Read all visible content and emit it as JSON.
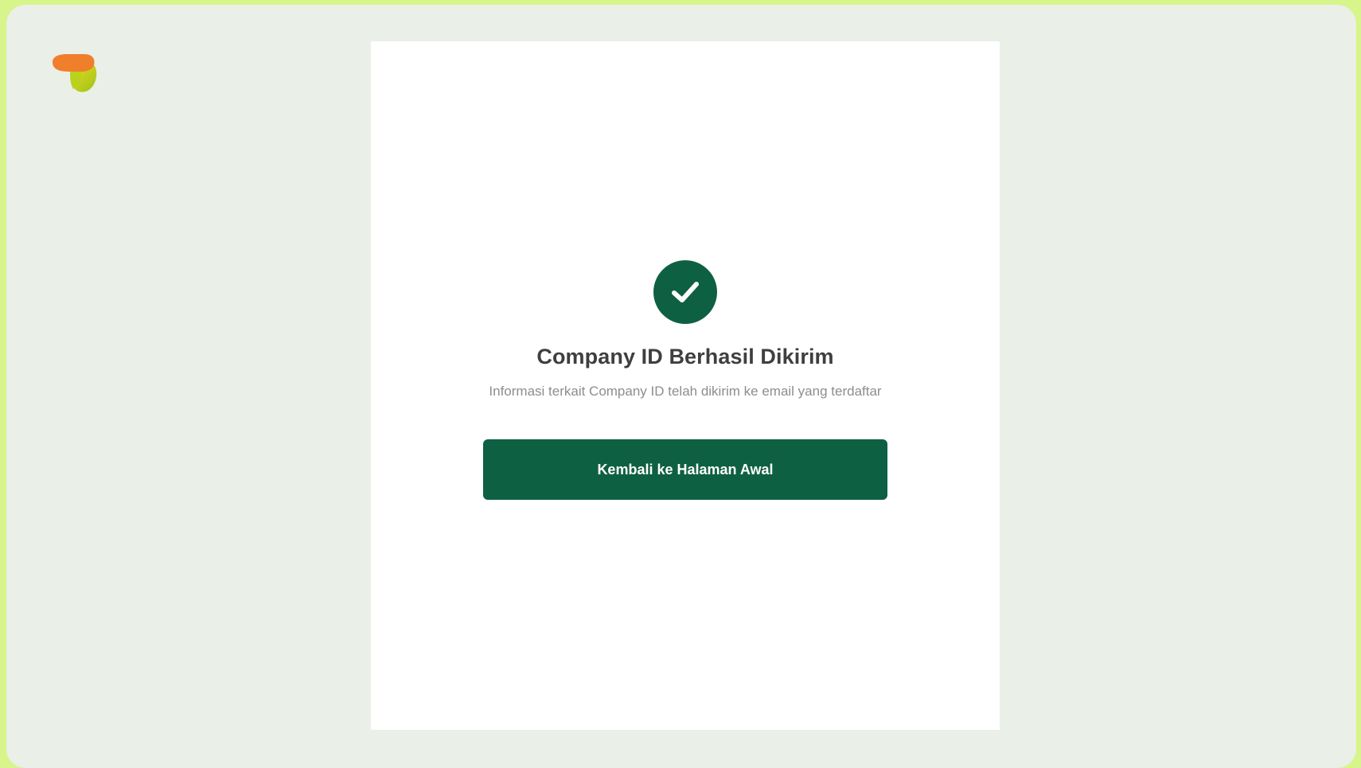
{
  "brand": {
    "logo_icon": "app-logo-icon",
    "logo_colors": [
      "#f07f2b",
      "#b9d21d",
      "#f2de1e"
    ]
  },
  "success": {
    "icon": "check-circle-icon",
    "title": "Company ID Berhasil Dikirim",
    "description": "Informasi terkait Company ID telah dikirim ke email yang terdaftar",
    "button_label": "Kembali ke Halaman Awal"
  },
  "colors": {
    "primary": "#0e6043",
    "page_background": "#eaefe8",
    "outer_border": "#d7f58a",
    "card_background": "#ffffff",
    "title_text": "#3f3f3f",
    "body_text": "#8d8d8d"
  }
}
